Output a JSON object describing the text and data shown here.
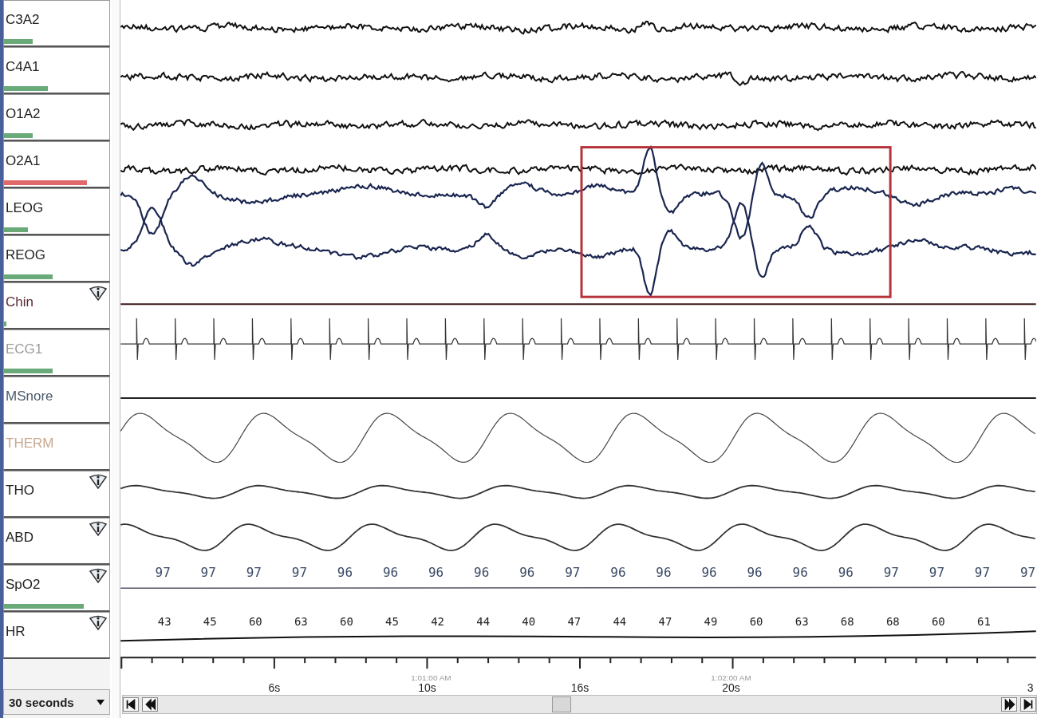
{
  "channels": [
    {
      "label": "C3A2",
      "color": "#222222",
      "level": 0.28,
      "alert": false,
      "info": false
    },
    {
      "label": "C4A1",
      "color": "#222222",
      "level": 0.42,
      "alert": false,
      "info": false
    },
    {
      "label": "O1A2",
      "color": "#222222",
      "level": 0.28,
      "alert": false,
      "info": false
    },
    {
      "label": "O2A1",
      "color": "#222222",
      "level": 0.8,
      "alert": true,
      "info": false
    },
    {
      "label": "LEOG",
      "color": "#222222",
      "level": 0.23,
      "alert": false,
      "info": false
    },
    {
      "label": "REOG",
      "color": "#222222",
      "level": 0.47,
      "alert": false,
      "info": false
    },
    {
      "label": "Chin",
      "color": "#5a2a36",
      "level": 0.02,
      "alert": false,
      "info": true
    },
    {
      "label": "ECG1",
      "color": "#9a9a9a",
      "level": 0.47,
      "alert": false,
      "info": false
    },
    {
      "label": "MSnore",
      "color": "#4a5a6a",
      "info": false
    },
    {
      "label": "THERM",
      "color": "#c8a890",
      "info": false
    },
    {
      "label": "THO",
      "color": "#222222",
      "info": true
    },
    {
      "label": "ABD",
      "color": "#222222",
      "info": true
    },
    {
      "label": "SpO2",
      "color": "#222222",
      "level": 0.77,
      "alert": false,
      "info": true
    },
    {
      "label": "HR",
      "color": "#222222",
      "info": true
    }
  ],
  "spo2_readings": [
    "97",
    "97",
    "97",
    "97",
    "96",
    "96",
    "96",
    "96",
    "96",
    "97",
    "96",
    "96",
    "96",
    "96",
    "96",
    "96",
    "97",
    "97",
    "97",
    "97"
  ],
  "hr_readings": [
    "43",
    "45",
    "60",
    "63",
    "60",
    "45",
    "42",
    "44",
    "40",
    "47",
    "44",
    "47",
    "49",
    "60",
    "63",
    "68",
    "68",
    "60",
    "61"
  ],
  "time_axis": {
    "labels": [
      "6s",
      "10s",
      "16s",
      "20s",
      "3"
    ],
    "clock_labels": [
      "1:01:00 AM",
      "1:02:00 AM"
    ]
  },
  "epoch_select": {
    "value": "30 seconds"
  }
}
